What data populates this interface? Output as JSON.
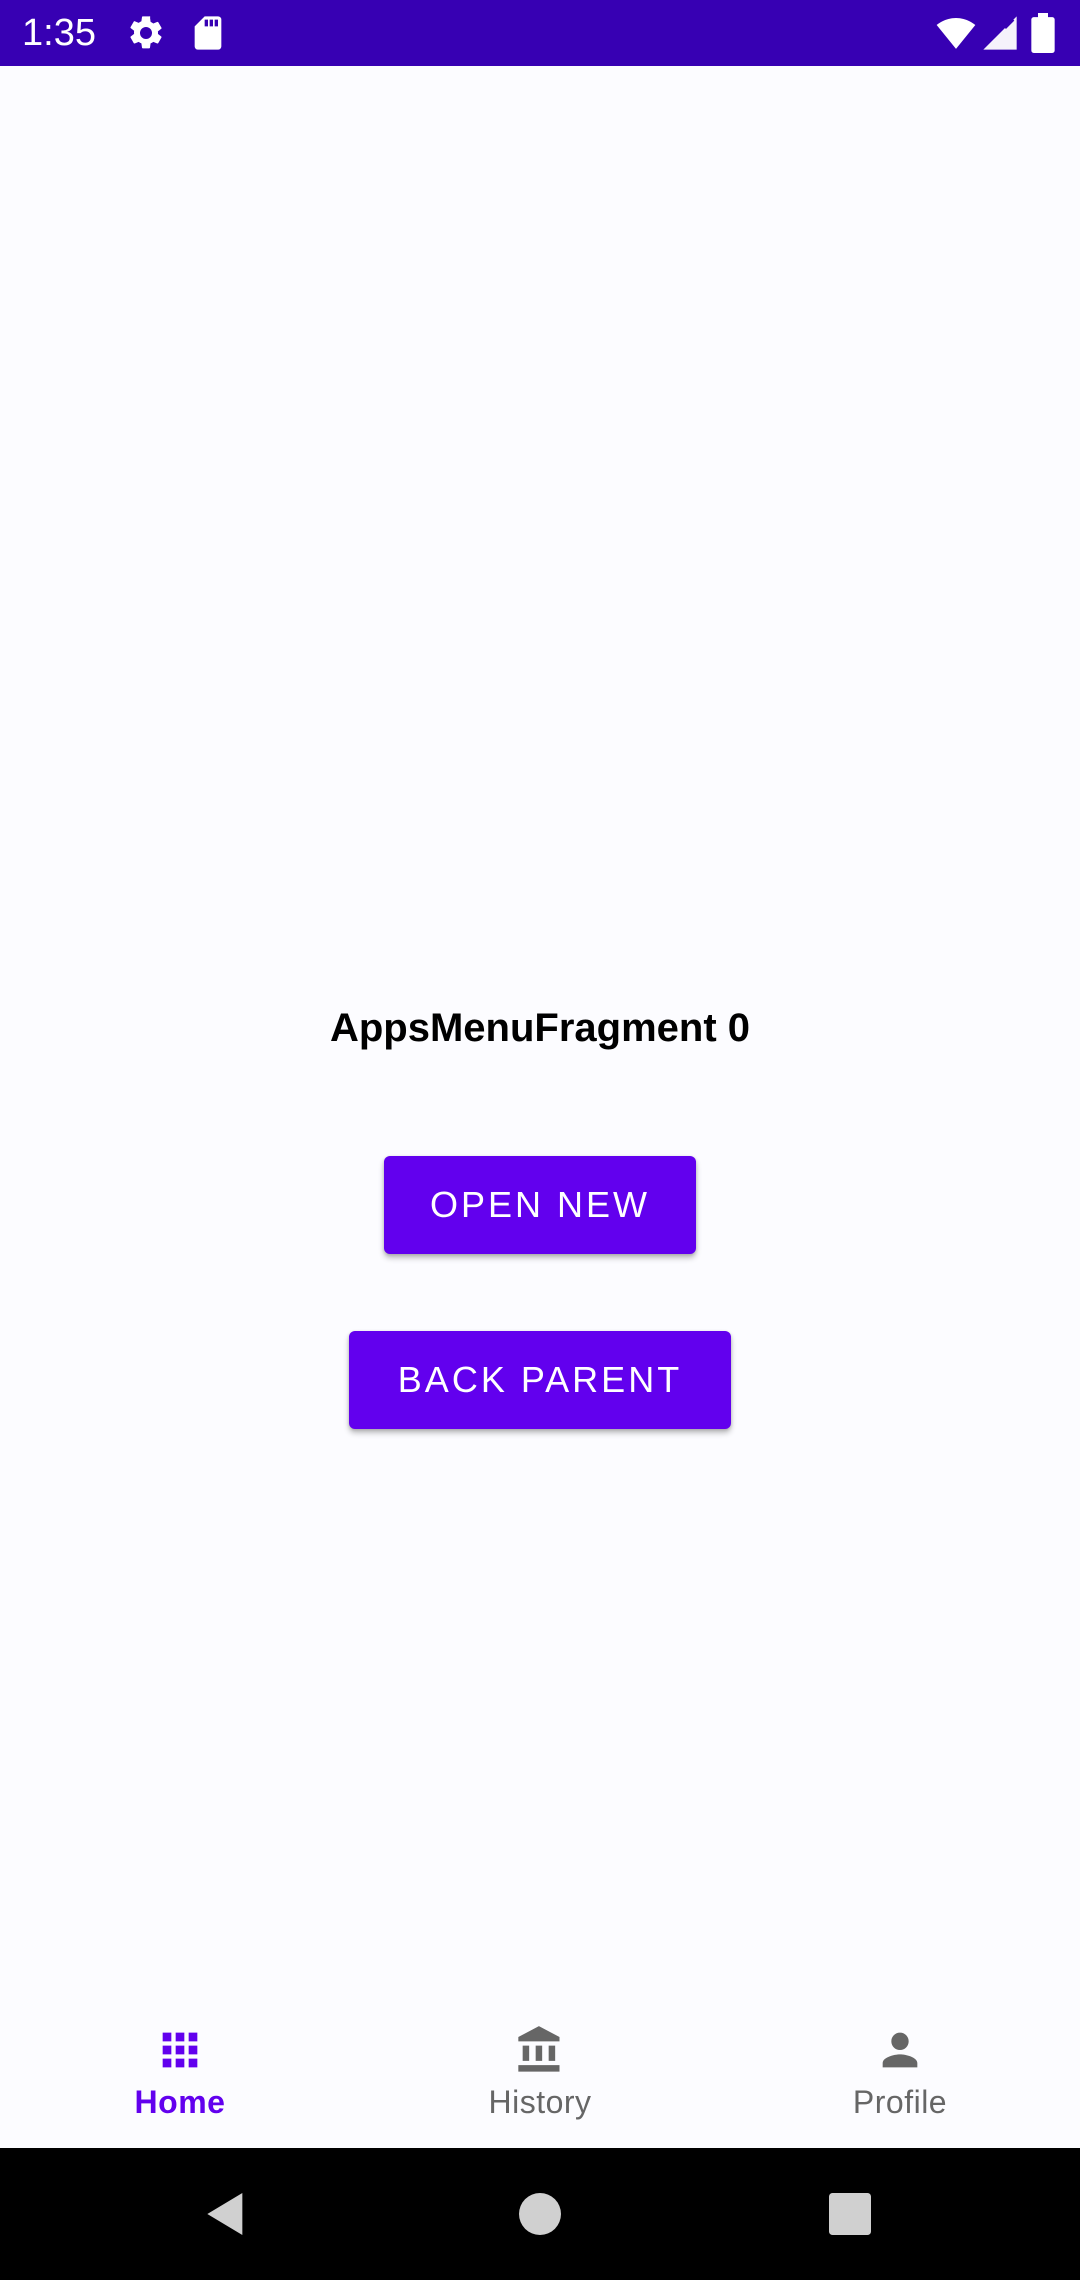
{
  "status_bar": {
    "time": "1:35",
    "icons": [
      "settings-gear-icon",
      "sd-card-icon",
      "wifi-icon",
      "cell-signal-icon",
      "battery-icon"
    ],
    "background_color": "#3700b3"
  },
  "main": {
    "fragment_title": "AppsMenuFragment 0",
    "open_new_label": "OPEN NEW",
    "back_parent_label": "BACK PARENT",
    "button_color": "#6200ee"
  },
  "bottom_nav": {
    "items": [
      {
        "label": "Home",
        "icon": "apps-grid-icon",
        "active": true
      },
      {
        "label": "History",
        "icon": "bank-icon",
        "active": false
      },
      {
        "label": "Profile",
        "icon": "person-icon",
        "active": false
      }
    ],
    "active_color": "#6200ee",
    "inactive_color": "#666666"
  },
  "system_nav": {
    "buttons": [
      "back-icon",
      "home-icon",
      "recents-icon"
    ]
  }
}
